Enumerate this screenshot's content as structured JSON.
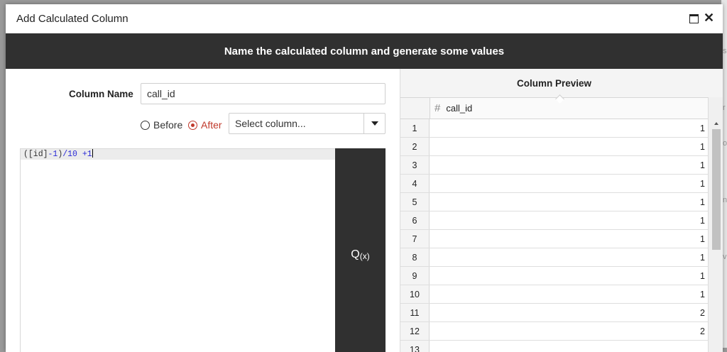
{
  "dialog": {
    "title": "Add Calculated Column",
    "banner": "Name the calculated column and generate some values",
    "close_glyph": "✕"
  },
  "form": {
    "column_name_label": "Column Name",
    "column_name_value": "call_id",
    "position_before_label": "Before",
    "position_after_label": "After",
    "position_selected": "After",
    "column_select_value": "Select column..."
  },
  "editor": {
    "expression": "([id]-1)/10 +1"
  },
  "qx_button": {
    "main": "Q",
    "sub": "(x)"
  },
  "preview": {
    "title": "Column Preview",
    "column_header": "call_id",
    "column_type_icon": "#",
    "rows": [
      {
        "n": "1",
        "v": "1"
      },
      {
        "n": "2",
        "v": "1"
      },
      {
        "n": "3",
        "v": "1"
      },
      {
        "n": "4",
        "v": "1"
      },
      {
        "n": "5",
        "v": "1"
      },
      {
        "n": "6",
        "v": "1"
      },
      {
        "n": "7",
        "v": "1"
      },
      {
        "n": "8",
        "v": "1"
      },
      {
        "n": "9",
        "v": "1"
      },
      {
        "n": "10",
        "v": "1"
      },
      {
        "n": "11",
        "v": "2"
      },
      {
        "n": "12",
        "v": "2"
      },
      {
        "n": "13",
        "v": ""
      }
    ]
  },
  "colors": {
    "banner_bg": "#303030",
    "accent_red": "#c0392b"
  }
}
